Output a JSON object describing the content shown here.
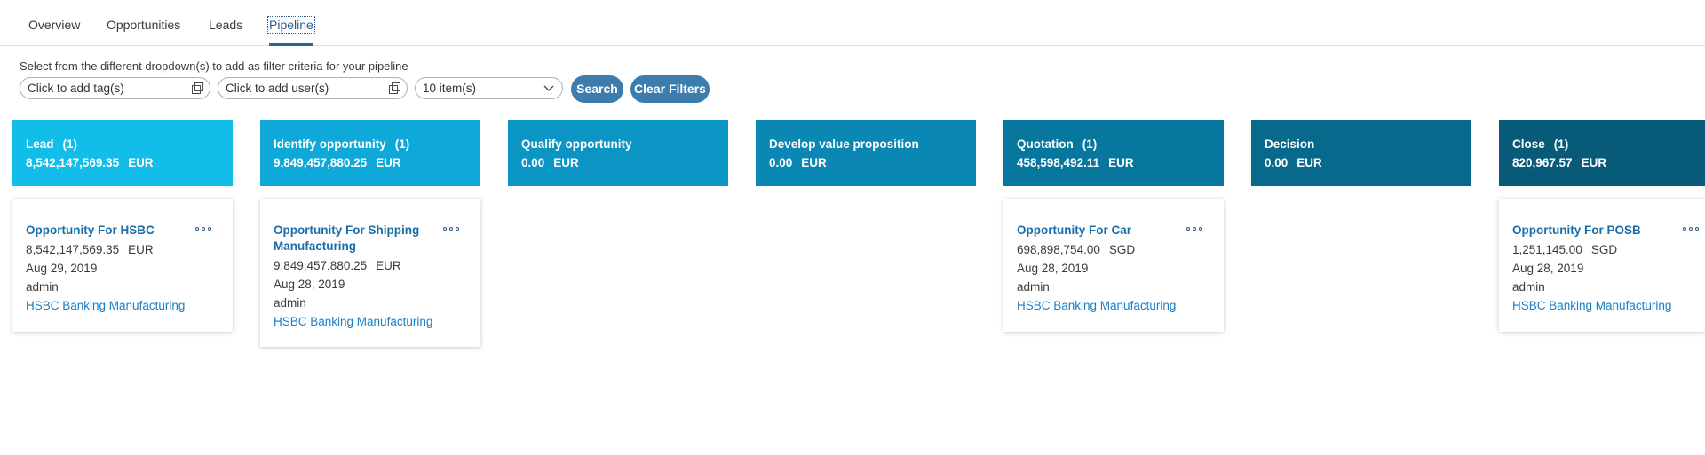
{
  "tabs": [
    {
      "label": "Overview"
    },
    {
      "label": "Opportunities"
    },
    {
      "label": "Leads"
    },
    {
      "label": "Pipeline"
    }
  ],
  "filters": {
    "hint": "Select from the different dropdown(s) to add as filter criteria for your pipeline",
    "tag_placeholder": "Click to add tag(s)",
    "user_placeholder": "Click to add user(s)",
    "items_selected": "10 item(s)",
    "search_label": "Search",
    "clear_label": "Clear Filters"
  },
  "stages": [
    {
      "name": "Lead",
      "count": "(1)",
      "amount": "8,542,147,569.35",
      "currency": "EUR",
      "color": "#12bdea"
    },
    {
      "name": "Identify opportunity",
      "count": "(1)",
      "amount": "9,849,457,880.25",
      "currency": "EUR",
      "color": "#0ea8d9"
    },
    {
      "name": "Qualify opportunity",
      "count": "",
      "amount": "0.00",
      "currency": "EUR",
      "color": "#0b95c4"
    },
    {
      "name": "Develop value proposition",
      "count": "",
      "amount": "0.00",
      "currency": "EUR",
      "color": "#0a88b3"
    },
    {
      "name": "Quotation",
      "count": "(1)",
      "amount": "458,598,492.11",
      "currency": "EUR",
      "color": "#08779e"
    },
    {
      "name": "Decision",
      "count": "",
      "amount": "0.00",
      "currency": "EUR",
      "color": "#07698b"
    },
    {
      "name": "Close",
      "count": "(1)",
      "amount": "820,967.57",
      "currency": "EUR",
      "color": "#075b79"
    }
  ],
  "cards": [
    {
      "title": "Opportunity For HSBC",
      "amount": "8,542,147,569.35",
      "currency": "EUR",
      "date": "Aug 29, 2019",
      "owner": "admin",
      "account": "HSBC Banking Manufacturing"
    },
    {
      "title": "Opportunity For Shipping Manufacturing",
      "amount": "9,849,457,880.25",
      "currency": "EUR",
      "date": "Aug 28, 2019",
      "owner": "admin",
      "account": "HSBC Banking Manufacturing"
    },
    {
      "title": "Opportunity For Car",
      "amount": "698,898,754.00",
      "currency": "SGD",
      "date": "Aug 28, 2019",
      "owner": "admin",
      "account": "HSBC Banking Manufacturing"
    },
    {
      "title": "Opportunity For POSB",
      "amount": "1,251,145.00",
      "currency": "SGD",
      "date": "Aug 28, 2019",
      "owner": "admin",
      "account": "HSBC Banking Manufacturing"
    }
  ]
}
